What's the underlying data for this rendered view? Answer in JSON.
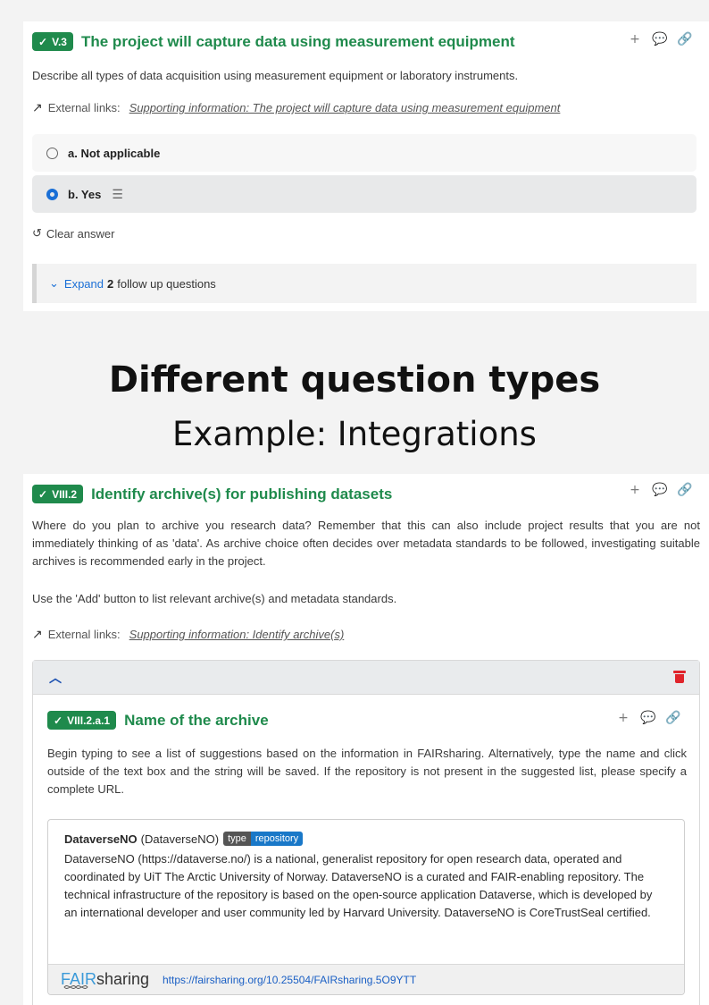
{
  "q1": {
    "badge": "V.3",
    "title": "The project will capture data using measurement equipment",
    "description": "Describe all types of data acquisition using measurement equipment or laboratory instruments.",
    "external_label": "External links:",
    "external_link": "Supporting information: The project will capture data using measurement equipment",
    "options": [
      {
        "label": "a. Not applicable",
        "selected": false
      },
      {
        "label": "b. Yes",
        "selected": true
      }
    ],
    "clear_label": "Clear answer",
    "expand_label": "Expand",
    "expand_count": "2",
    "expand_rest": "follow up questions"
  },
  "headline": {
    "title": "Different question types",
    "subtitle": "Example: Integrations"
  },
  "q2": {
    "badge": "VIII.2",
    "title": "Identify archive(s) for publishing datasets",
    "description": "Where do you plan to archive you research data? Remember that this can also include project results that you are not immediately thinking of as 'data'. As archive choice often decides over metadata standards to be followed, investigating suitable archives is recommended early in the project.",
    "description2": "Use the 'Add' button to list relevant archive(s) and metadata standards.",
    "external_label": "External links:",
    "external_link": "Supporting information: Identify archive(s)",
    "sub": {
      "badge": "VIII.2.a.1",
      "title": "Name of the archive",
      "description": "Begin typing to see a list of suggestions based on the information in FAIRsharing. Alternatively, type the name and click outside of the text box and the string will be saved. If the repository is not present in the suggested list, please specify a complete URL.",
      "card": {
        "name": "DataverseNO",
        "paren": "(DataverseNO)",
        "tag_key": "type",
        "tag_value": "repository",
        "text": "DataverseNO (https://dataverse.no/) is a national, generalist repository for open research data, operated and coordinated by UiT The Arctic University of Norway. DataverseNO is a curated and FAIR-enabling repository. The technical infrastructure of the repository is based on the open-source application Dataverse, which is developed by an international developer and user community led by Harvard University. DataverseNO is CoreTrustSeal certified.",
        "logo_fair": "FAIR",
        "logo_sharing": "sharing",
        "link": "https://fairsharing.org/10.25504/FAIRsharing.5O9YTT"
      }
    }
  },
  "colors": {
    "green": "#1f8a4c",
    "blue": "#1a6fd6",
    "red": "#e0242b"
  }
}
